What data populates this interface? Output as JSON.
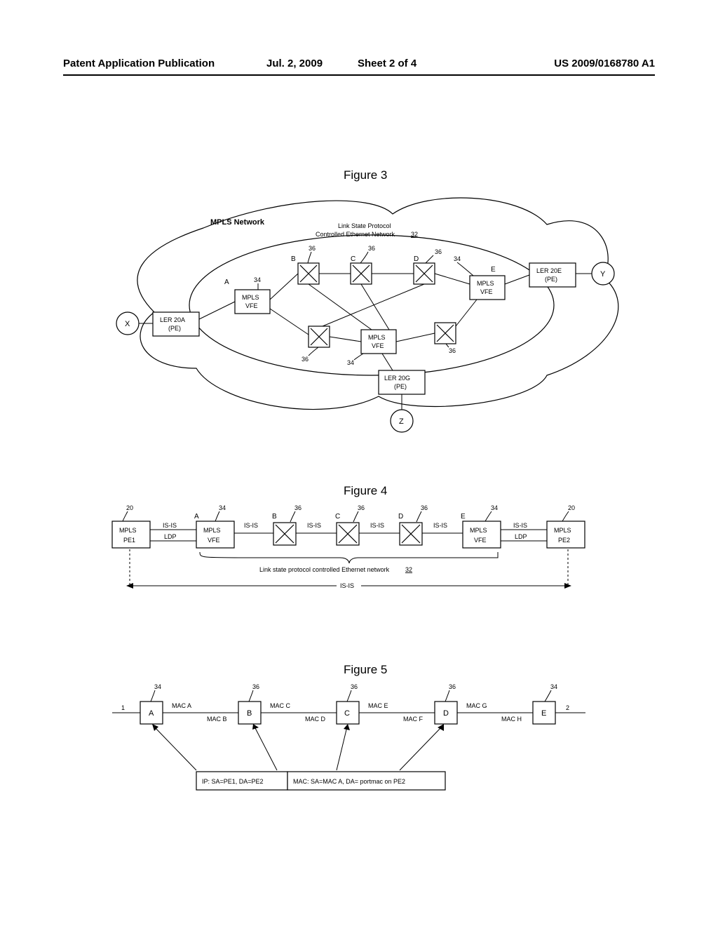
{
  "header": {
    "left": "Patent Application Publication",
    "date": "Jul. 2, 2009",
    "sheet": "Sheet 2 of 4",
    "pubno": "US 2009/0168780 A1"
  },
  "fig3": {
    "title": "Figure 3",
    "mpls_network": "MPLS Network",
    "lspce_title1": "Link State Protocol",
    "lspce_title2": "Controlled Ethernet Network",
    "lspce_ref": "32",
    "letters": {
      "A": "A",
      "B": "B",
      "C": "C",
      "D": "D",
      "E": "E"
    },
    "ref34": "34",
    "ref36": "36",
    "vfe": "MPLS\nVFE",
    "ler_a1": "LER 20A",
    "ler_a2": "(PE)",
    "ler_e1": "LER 20E",
    "ler_e2": "(PE)",
    "ler_g1": "LER 20G",
    "ler_g2": "(PE)",
    "X": "X",
    "Y": "Y",
    "Z": "Z"
  },
  "fig4": {
    "title": "Figure 4",
    "pe1": "MPLS\nPE1",
    "pe2": "MPLS\nPE2",
    "vfe": "MPLS\nVFE",
    "isis": "IS-IS",
    "ldp": "LDP",
    "letters": {
      "A": "A",
      "B": "B",
      "C": "C",
      "D": "D",
      "E": "E"
    },
    "ref20": "20",
    "ref34": "34",
    "ref36": "36",
    "caption": "Link state protocol controlled Ethernet network",
    "caption_ref": "32",
    "bottom": "IS-IS"
  },
  "fig5": {
    "title": "Figure 5",
    "nodes": {
      "A": "A",
      "B": "B",
      "C": "C",
      "D": "D",
      "E": "E"
    },
    "macA": "MAC A",
    "macB": "MAC B",
    "macC": "MAC C",
    "macD": "MAC D",
    "macE": "MAC E",
    "macF": "MAC F",
    "macG": "MAC G",
    "macH": "MAC H",
    "ref34": "34",
    "ref36": "36",
    "one": "1",
    "two": "2",
    "pkt1": "IP: SA=PE1, DA=PE2",
    "pkt2": "MAC: SA=MAC A, DA= portmac on PE2"
  }
}
